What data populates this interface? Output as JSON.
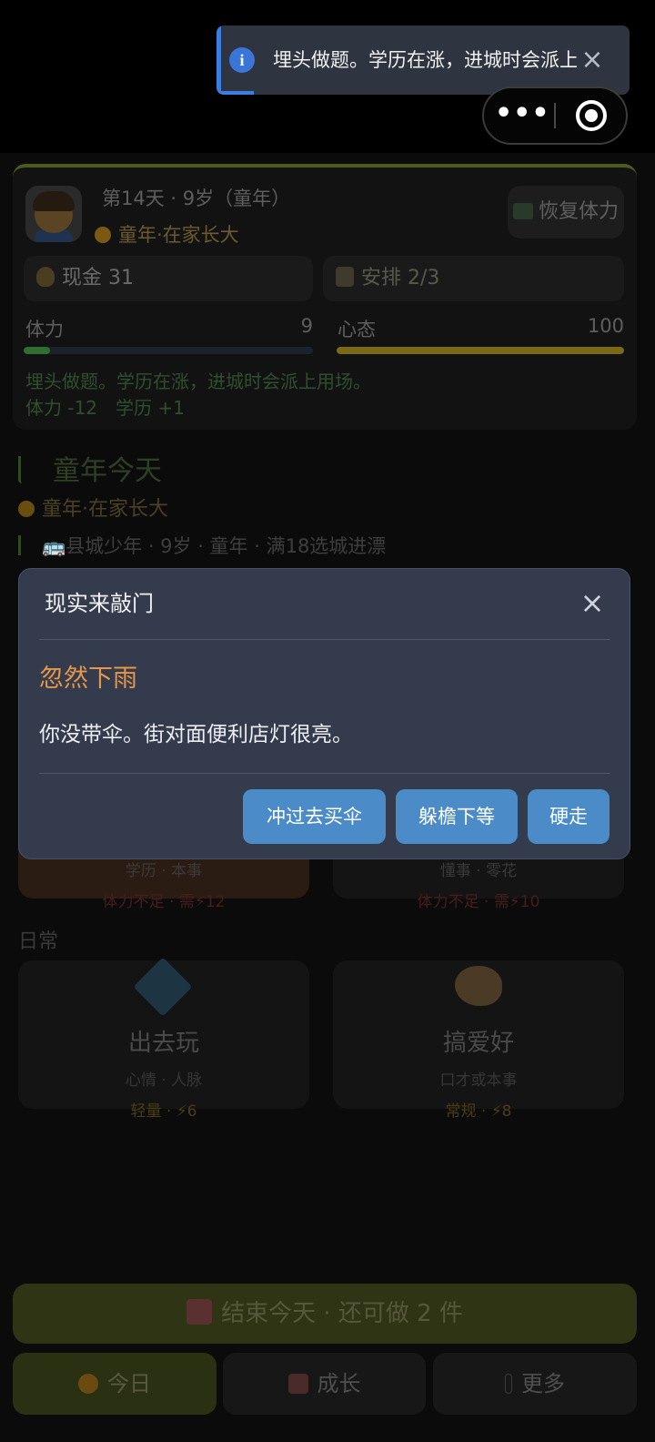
{
  "toast": {
    "icon": "info-icon",
    "text": "埋头做题。学历在涨，进城时会派上用场。",
    "accent_color": "#3b7ee0",
    "progress": 0.09
  },
  "capsule": {
    "more_glyph": "•••",
    "icons": [
      "more-icon",
      "target-icon"
    ]
  },
  "header": {
    "day_line": "第14天 · 9岁（童年）",
    "stage": "童年·在家长大",
    "recover_label": "恢复体力",
    "accent_color": "#4c5a21"
  },
  "stats": {
    "cash_label": "现金 31",
    "plan_label": "安排 2/3",
    "stamina": {
      "label": "体力",
      "value": "9",
      "fill": 0.09,
      "color": "#2f6e2f"
    },
    "mood": {
      "label": "心态",
      "value": "100",
      "fill": 1.0,
      "color": "#7a6a15"
    }
  },
  "feedback": {
    "message": "埋头做题。学历在涨，进城时会派上用场。",
    "delta": "体力 -12　学历 +1"
  },
  "today": {
    "title": "童年今天",
    "stage": "童年·在家长大",
    "info": "🚌县城少年 · 9岁 · 童年 · 满18选城进漂"
  },
  "hidden_cards": [
    {
      "desc": "学历 · 本事",
      "warning": "体力不足 · 需⚡12"
    },
    {
      "desc": "懂事 · 零花",
      "warning": "体力不足 · 需⚡10"
    }
  ],
  "daily": {
    "label": "日常",
    "cards": [
      {
        "icon": "kite-icon",
        "title": "出去玩",
        "desc": "心情 · 人脉",
        "cost": "轻量 · ⚡6"
      },
      {
        "icon": "palette-icon",
        "title": "搞爱好",
        "desc": "口才或本事",
        "cost": "常规 · ⚡8"
      }
    ]
  },
  "end_button": "结束今天 · 还可做 2 件",
  "nav": {
    "today": "今日",
    "growth": "成长",
    "more": "更多"
  },
  "modal": {
    "title": "现实来敲门",
    "heading": "忽然下雨",
    "body": "你没带伞。街对面便利店灯很亮。",
    "buttons": [
      "冲过去买伞",
      "躲檐下等",
      "硬走"
    ],
    "heading_color": "#e6974a",
    "button_color": "#4a8bc8"
  }
}
